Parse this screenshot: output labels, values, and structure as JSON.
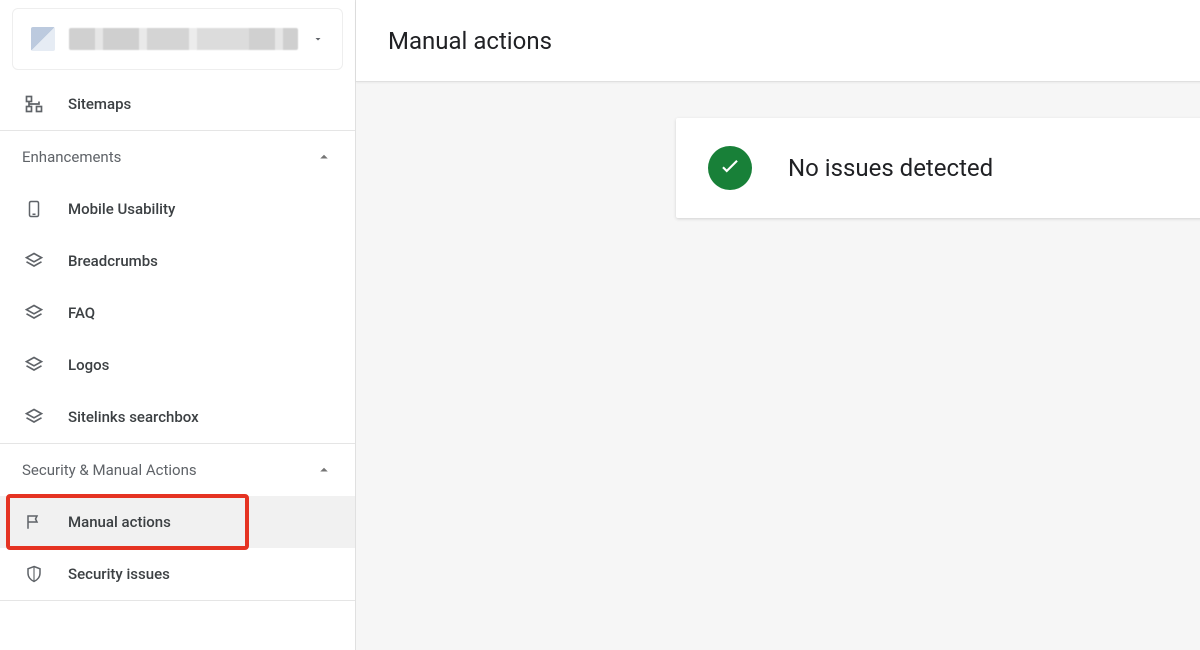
{
  "sidebar": {
    "property_label": "",
    "top_items": [
      {
        "label": "Sitemaps",
        "icon": "sitemap-icon"
      }
    ],
    "sections": [
      {
        "label": "Enhancements",
        "items": [
          {
            "label": "Mobile Usability",
            "icon": "smartphone-icon"
          },
          {
            "label": "Breadcrumbs",
            "icon": "layers-icon"
          },
          {
            "label": "FAQ",
            "icon": "layers-icon"
          },
          {
            "label": "Logos",
            "icon": "layers-icon"
          },
          {
            "label": "Sitelinks searchbox",
            "icon": "layers-icon"
          }
        ]
      },
      {
        "label": "Security & Manual Actions",
        "items": [
          {
            "label": "Manual actions",
            "icon": "flag-icon",
            "selected": true
          },
          {
            "label": "Security issues",
            "icon": "shield-icon"
          }
        ]
      }
    ]
  },
  "main": {
    "title": "Manual actions",
    "status_message": "No issues detected",
    "status_color": "#188038"
  }
}
